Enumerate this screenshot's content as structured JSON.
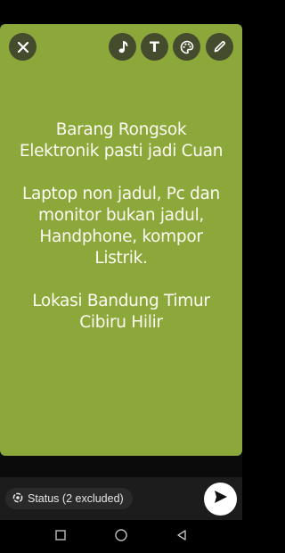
{
  "theme": {
    "canvas_background": "#8ca83a",
    "text_color": "#fbfbf4",
    "bottom_bar": "#1c1c1c",
    "send_button": "#ffffff",
    "send_arrow": "#111111"
  },
  "editor_toolbar": {
    "close_icon": "close-icon",
    "tools": [
      {
        "name": "music",
        "icon": "music-note-icon"
      },
      {
        "name": "text",
        "icon": "text-t-icon",
        "glyph": "T"
      },
      {
        "name": "color",
        "icon": "palette-icon"
      },
      {
        "name": "draw",
        "icon": "pencil-icon"
      }
    ]
  },
  "status_text": {
    "paragraphs": [
      {
        "lines": [
          "Barang Rongsok",
          "Elektronik pasti jadi Cuan"
        ]
      },
      {
        "lines": [
          "Laptop non jadul, Pc dan",
          "monitor bukan jadul,",
          "Handphone, kompor",
          "Listrik."
        ]
      },
      {
        "lines": [
          "Lokasi Bandung Timur",
          "Cibiru Hilir"
        ]
      }
    ]
  },
  "bottom_bar": {
    "audience_label": "Status (2 excluded)",
    "audience_icon": "status-ring-icon",
    "send_icon": "send-arrow-icon"
  },
  "system_nav": {
    "recent": "recent-apps-icon",
    "home": "home-icon",
    "back": "back-icon"
  }
}
